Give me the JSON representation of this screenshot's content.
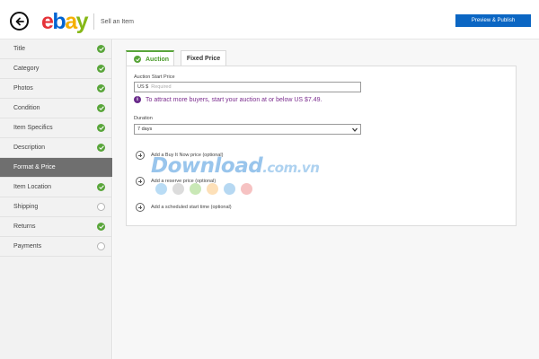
{
  "header": {
    "back_icon": "back-arrow-icon",
    "logo": {
      "e": "e",
      "b": "b",
      "a": "a",
      "y": "y"
    },
    "title": "Sell an Item",
    "publish_label": "Preview & Publish"
  },
  "sidebar": {
    "items": [
      {
        "label": "Title",
        "status": "done"
      },
      {
        "label": "Category",
        "status": "done"
      },
      {
        "label": "Photos",
        "status": "done"
      },
      {
        "label": "Condition",
        "status": "done"
      },
      {
        "label": "Item Specifics",
        "status": "done"
      },
      {
        "label": "Description",
        "status": "done"
      },
      {
        "label": "Format & Price",
        "status": "active"
      },
      {
        "label": "Item Location",
        "status": "done"
      },
      {
        "label": "Shipping",
        "status": "todo"
      },
      {
        "label": "Returns",
        "status": "done"
      },
      {
        "label": "Payments",
        "status": "todo"
      }
    ]
  },
  "tabs": {
    "auction": "Auction",
    "fixed": "Fixed Price"
  },
  "form": {
    "start_price_label": "Auction Start Price",
    "currency": "US $",
    "price_placeholder": "Required",
    "info_text": "To attract more buyers, start your auction at or below US $7.49.",
    "duration_label": "Duration",
    "duration_value": "7 days",
    "add_buy_now": "Add a Buy It Now price (optional)",
    "add_reserve": "Add a reserve price (optional)",
    "add_schedule": "Add a scheduled start time (optional)"
  },
  "watermark": {
    "main": "Download",
    "suffix": ".com.vn",
    "dot_colors": [
      "#b9dcf5",
      "#dcdcdc",
      "#c9e8b6",
      "#fde0b8",
      "#b6d8f2",
      "#f6c2c2"
    ]
  },
  "colors": {
    "accent_blue": "#0b66c3",
    "done_green": "#59a53a",
    "active_bg": "#6f6f6f",
    "info_purple": "#7b2d8e"
  }
}
